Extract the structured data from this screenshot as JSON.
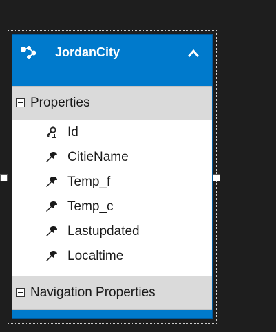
{
  "entity": {
    "title": "JordanCity",
    "header_icon": "entity-icon",
    "collapse_icon": "chevron-up-icon",
    "colors": {
      "header": "#007acc",
      "section": "#dadada",
      "background": "#1e1e1e"
    }
  },
  "sections": {
    "properties": {
      "label": "Properties",
      "toggle_icon": "collapse-minus-icon"
    },
    "navigation": {
      "label": "Navigation Properties",
      "toggle_icon": "collapse-minus-icon"
    }
  },
  "properties": [
    {
      "name": "Id",
      "icon": "key-icon"
    },
    {
      "name": "CitieName",
      "icon": "wrench-icon"
    },
    {
      "name": "Temp_f",
      "icon": "wrench-icon"
    },
    {
      "name": "Temp_c",
      "icon": "wrench-icon"
    },
    {
      "name": "Lastupdated",
      "icon": "wrench-icon"
    },
    {
      "name": "Localtime",
      "icon": "wrench-icon"
    }
  ]
}
